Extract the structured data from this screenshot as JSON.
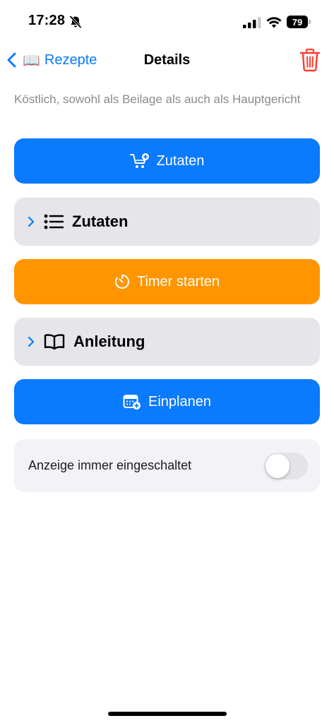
{
  "status_bar": {
    "time": "17:28",
    "battery": "79"
  },
  "nav": {
    "back_label": "Rezepte",
    "back_emoji": "📖",
    "title": "Details"
  },
  "recipe": {
    "description": "Köstlich, sowohl als Beilage als auch als Hauptgericht"
  },
  "actions": {
    "add_ingredients_label": "Zutaten",
    "ingredients_section_label": "Zutaten",
    "timer_label": "Timer starten",
    "instructions_section_label": "Anleitung",
    "schedule_label": "Einplanen"
  },
  "settings": {
    "always_on_label": "Anzeige immer eingeschaltet",
    "always_on_value": false
  },
  "colors": {
    "accent": "#0a7aff",
    "timer": "#ff9500",
    "destructive": "#ff3b30"
  },
  "icons": {
    "back": "chevron-left-icon",
    "trash": "trash-icon",
    "cart_add": "cart-plus-icon",
    "list": "list-icon",
    "timer": "timer-icon",
    "book": "book-icon",
    "calendar_add": "calendar-plus-icon"
  }
}
